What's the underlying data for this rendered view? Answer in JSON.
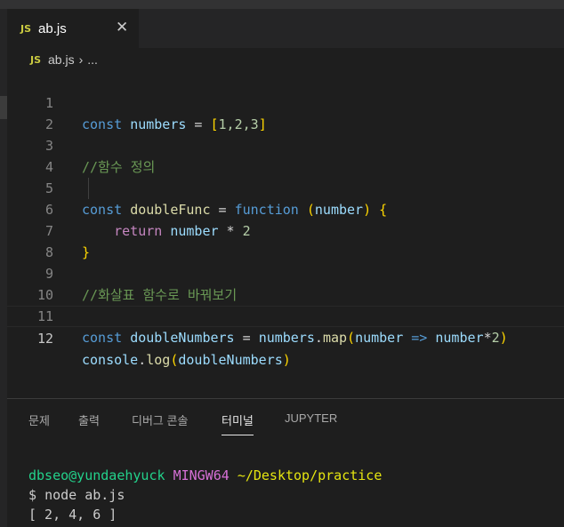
{
  "editor_tab": {
    "badge": "JS",
    "label": "ab.js",
    "close_glyph": "✕"
  },
  "breadcrumb": {
    "badge": "JS",
    "file": "ab.js",
    "separator": "›",
    "ellipsis": "..."
  },
  "code": {
    "line_numbers": [
      "1",
      "2",
      "3",
      "4",
      "5",
      "6",
      "7",
      "8",
      "9",
      "10",
      "11",
      "12"
    ],
    "active_line": "12",
    "l1": {
      "kw": "const",
      "var": "numbers",
      "op": " = ",
      "open": "[",
      "items": "1,2,3",
      "close": "]"
    },
    "l3": {
      "comment": "//함수 정의"
    },
    "l5": {
      "kw": "const",
      "fname": "doubleFunc",
      "op": " = ",
      "kw2": "function",
      "open": "(",
      "param": "number",
      "close": ")",
      "brace": "{"
    },
    "l6": {
      "ret": "return",
      "var": "number",
      "op": " * ",
      "num": "2"
    },
    "l7": {
      "brace": "}"
    },
    "l9": {
      "comment": "//화살표 함수로 바꿔보기"
    },
    "l11": {
      "kw": "const",
      "name": "doubleNumbers",
      "op": " = ",
      "obj": "numbers",
      "dot": ".",
      "method": "map",
      "open": "(",
      "param": "number",
      "arrow": " => ",
      "var": "number",
      "star": "*",
      "num": "2",
      "close": ")"
    },
    "l12": {
      "obj": "console",
      "dot": ".",
      "method": "log",
      "open": "(",
      "arg": "doubleNumbers",
      "close": ")"
    }
  },
  "panel": {
    "tabs": [
      "문제",
      "출력",
      "디버그 콘솔",
      "터미널",
      "JUPYTER"
    ],
    "active_tab": "터미널"
  },
  "terminal": {
    "user_host": "dbseo@yundaehyuck",
    "env": "MINGW64",
    "path": "~/Desktop/practice",
    "prompt": "$",
    "command": "node ab.js",
    "output": "[ 2, 4, 6 ]"
  },
  "colors": {
    "background": "#1e1e1e",
    "keyword": "#569cd6",
    "variable": "#9cdcfe",
    "function": "#dcdcaa",
    "comment": "#6a9955",
    "js_badge": "#cbcb41"
  }
}
